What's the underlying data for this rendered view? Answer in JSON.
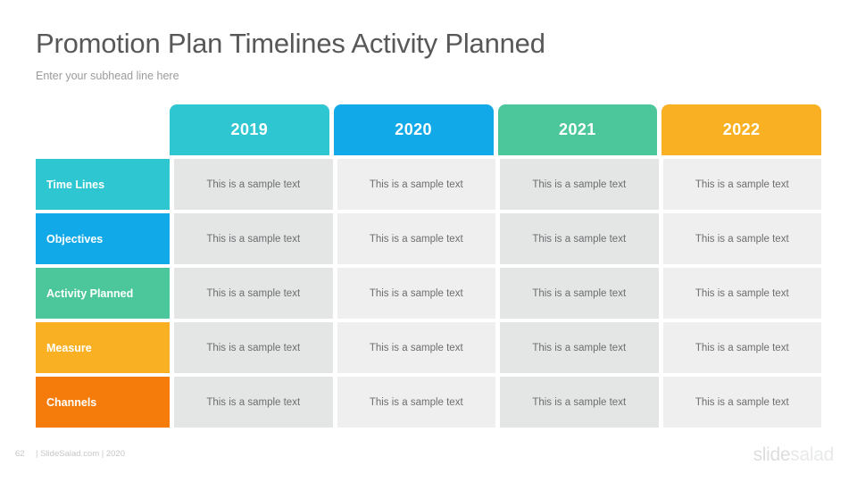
{
  "slide": {
    "title": "Promotion Plan Timelines Activity Planned",
    "subhead": "Enter your subhead line here"
  },
  "table": {
    "columns": [
      {
        "label": "2019",
        "color": "#2ec7d1"
      },
      {
        "label": "2020",
        "color": "#12a9e8"
      },
      {
        "label": "2021",
        "color": "#4cc79b"
      },
      {
        "label": "2022",
        "color": "#f9b022"
      }
    ],
    "rows": [
      {
        "label": "Time Lines",
        "color": "#2ec7d1",
        "cells": [
          "This is a sample text",
          "This is a sample text",
          "This is a sample text",
          "This is a sample text"
        ]
      },
      {
        "label": "Objectives",
        "color": "#12a9e8",
        "cells": [
          "This is a sample text",
          "This is a sample text",
          "This is a sample text",
          "This is a sample text"
        ]
      },
      {
        "label": "Activity Planned",
        "color": "#4cc79b",
        "cells": [
          "This is a sample text",
          "This is a sample text",
          "This is a sample text",
          "This is a sample text"
        ]
      },
      {
        "label": "Measure",
        "color": "#f9b022",
        "cells": [
          "This is a sample text",
          "This is a sample text",
          "This is a sample text",
          "This is a sample text"
        ]
      },
      {
        "label": "Channels",
        "color": "#f57c0a",
        "cells": [
          "This is a sample text",
          "This is a sample text",
          "This is a sample text",
          "This is a sample text"
        ]
      }
    ]
  },
  "footer": {
    "page_number": "62",
    "credit": "| SlideSalad.com | 2020",
    "watermark_first": "slide",
    "watermark_second": "salad"
  }
}
